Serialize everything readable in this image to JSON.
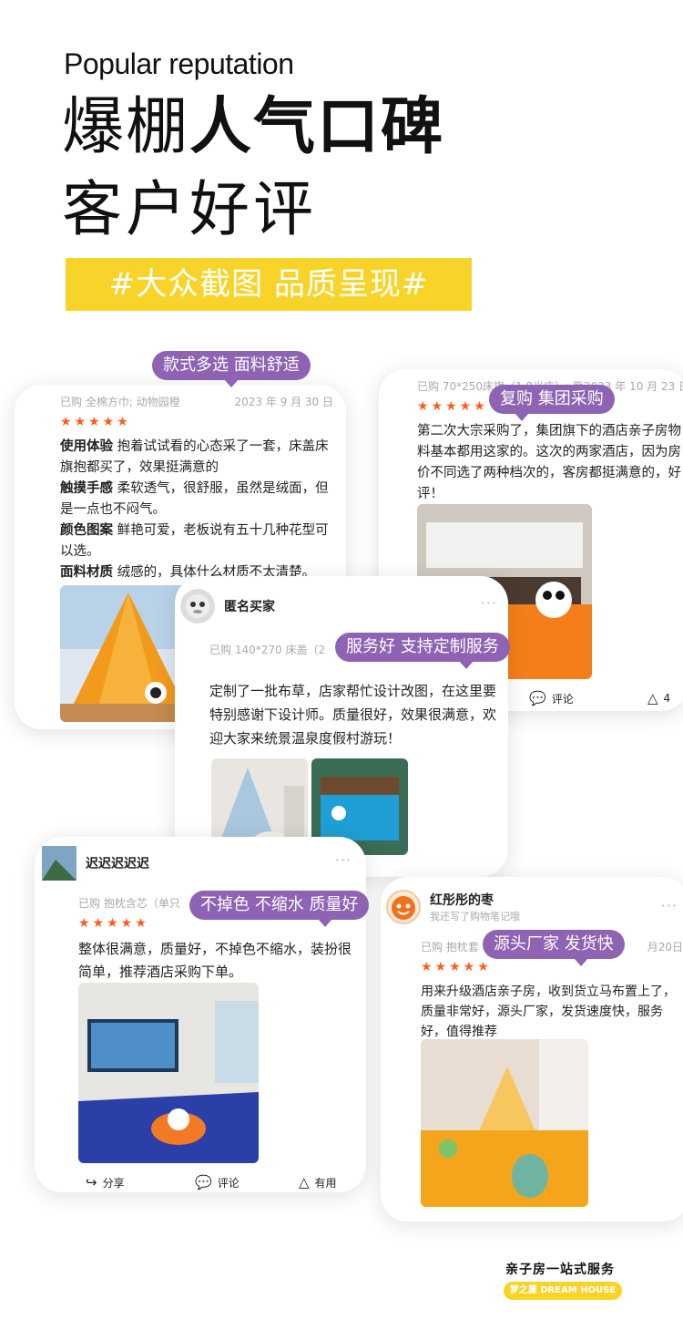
{
  "header": {
    "en_title": "Popular reputation",
    "title_thin": "爆棚",
    "title_bold": "人气口碑",
    "subtitle": "客户好评",
    "tagline": "#大众截图 品质呈现#"
  },
  "reviews": [
    {
      "bubble": "款式多选 面料舒适",
      "purchased": "已购 全棉方巾; 动物园橙",
      "date": "2023 年 9 月 30 日",
      "stars": "★★★★★",
      "lines": [
        {
          "label": "使用体验",
          "text": " 抱着试试看的心态采了一套，床盖床旗抱都买了，效果挺满意的"
        },
        {
          "label": "触摸手感",
          "text": " 柔软透气，很舒服，虽然是绒面，但是一点也不闷气。"
        },
        {
          "label": "颜色图案",
          "text": " 鲜艳可爱，老板说有五十几种花型可以选。"
        },
        {
          "label": "面料材质",
          "text": " 绒感的，具体什么材质不太清楚。"
        }
      ]
    },
    {
      "bubble": "复购 集团采购",
      "purchased": "已购 70*250床旗（1.8米床）; 熊",
      "date": "2023 年 10 月 23 日",
      "stars": "★★★★★",
      "text": "第二次大宗采购了，集团旗下的酒店亲子房物料基本都用这家的。这次的两家酒店，因为房价不同选了两种档次的，客房都挺满意的，好评！",
      "comment": "评论",
      "useful_count": "4"
    },
    {
      "bubble": "服务好 支持定制服务",
      "user": "匿名买家",
      "purchased": "已购 140*270 床盖（2",
      "text": "定制了一批布草，店家帮忙设计改图，在这里要特别感谢下设计师。质量很好，效果很满意，欢迎大家来统景温泉度假村游玩！"
    },
    {
      "bubble": "不掉色 不缩水 质量好",
      "user": "迟迟迟迟迟",
      "purchased": "已购 抱枕含芯（单只",
      "stars": "★★★★★",
      "text": "整体很满意，质量好，不掉色不缩水，装扮很简单，推荐酒店采购下单。",
      "share": "分享",
      "comment": "评论",
      "useful": "有用"
    },
    {
      "bubble": "源头厂家 发货快",
      "user": "红彤彤的枣",
      "user_sub": "我还写了购物笔记哦",
      "purchased": "已购 抱枕套",
      "date": "月20日",
      "stars": "★★★★★",
      "text": "用来升级酒店亲子房，收到货立马布置上了，质量非常好，源头厂家，发货速度快，服务好，值得推荐"
    }
  ],
  "more_dots": "···",
  "icons": [
    "share-icon",
    "comment-icon",
    "thumb-icon"
  ],
  "colors": {
    "accent_yellow": "#f8d42a",
    "bubble_purple": "#8e63b3",
    "star_orange": "#ff5b1f"
  },
  "footer": {
    "main": "亲子房一站式服务",
    "pill": "梦之屋 DREAM HOUSE"
  }
}
